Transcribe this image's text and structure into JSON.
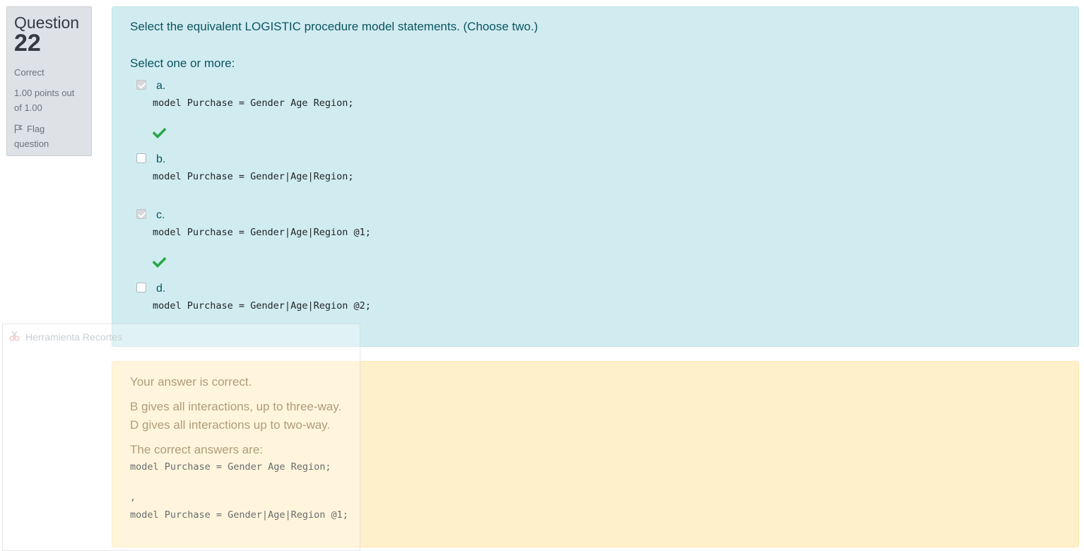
{
  "question_info": {
    "label": "Question",
    "number": "22",
    "state": "Correct",
    "grade_line1": "1.00 points out",
    "grade_line2": "of 1.00",
    "flag_line1": "Flag",
    "flag_line2": "question"
  },
  "formulation": {
    "question_text": "Select the equivalent LOGISTIC procedure model statements. (Choose two.)",
    "prompt": "Select one or more:",
    "options": [
      {
        "letter": "a.",
        "code": "model Purchase = Gender Age Region;",
        "checked": true,
        "correct_mark": true
      },
      {
        "letter": "b.",
        "code": "model Purchase = Gender|Age|Region;",
        "checked": false,
        "correct_mark": false
      },
      {
        "letter": "c.",
        "code": "model Purchase = Gender|Age|Region @1;",
        "checked": true,
        "correct_mark": true
      },
      {
        "letter": "d.",
        "code": "model Purchase = Gender|Age|Region @2;",
        "checked": false,
        "correct_mark": false
      }
    ]
  },
  "feedback": {
    "result": "Your answer is correct.",
    "explanation_line1": "B gives all interactions, up to three-way.",
    "explanation_line2": "D gives all interactions up to two-way.",
    "correct_answers_label": "The correct answers are:",
    "answer1": "model Purchase = Gender Age Region;",
    "separator": ",",
    "answer2": "model Purchase = Gender|Age|Region @1;"
  },
  "overlay": {
    "title": "Herramienta Recortes",
    "icon": "scissors-icon"
  },
  "colors": {
    "info_bg": "#dee2e6",
    "formulation_bg": "#d1ecf1",
    "feedback_bg": "#fff0cc",
    "correct_tick": "#28a745"
  }
}
